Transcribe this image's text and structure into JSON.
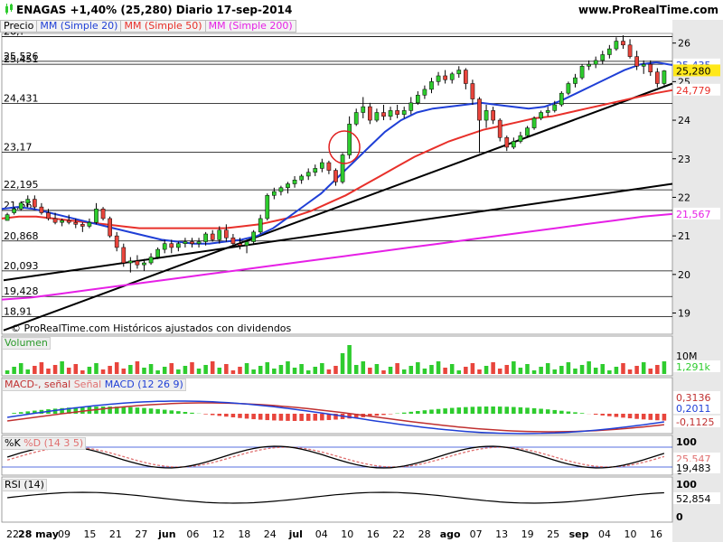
{
  "header": {
    "title": "ENAGAS   +1,40% (25,280)   Diario   17-sep-2014",
    "site": "www.ProRealTime.com"
  },
  "legend": {
    "price": "Precio",
    "ma20": "MM (Simple 20)",
    "ma50": "MM (Simple 50)",
    "ma200": "MM (Simple 200)"
  },
  "footnote": "© ProRealTime.com  Históricos ajustados con dividendos",
  "panels": {
    "volume": "Volumen",
    "macd": {
      "a": "MACD-, señal",
      "b": "Señal",
      "c": "MACD (12 26 9)"
    },
    "stoch": {
      "a": "%K",
      "b": "%D (14 3 5)"
    },
    "rsi": "RSI (14)"
  },
  "colors": {
    "up": "#2ecc2e",
    "down": "#e8453c",
    "ma20": "#1f3fd6",
    "ma50": "#e8302a",
    "ma200": "#e620e6",
    "circle": "#e02020",
    "right_bg": "#e8e8e8"
  },
  "chart_data": {
    "type": "candlestick",
    "x_labels": [
      "22",
      "28 may",
      "09",
      "15",
      "21",
      "27",
      "jun",
      "06",
      "12",
      "18",
      "24",
      "jul",
      "04",
      "10",
      "16",
      "22",
      "28",
      "ago",
      "07",
      "13",
      "19",
      "25",
      "sep",
      "04",
      "10",
      "16"
    ],
    "price_axis_ticks": [
      19,
      20,
      21,
      22,
      23,
      24,
      25,
      26
    ],
    "price_levels": [
      "26,?",
      "25,526",
      "25,451",
      "24,431",
      "23,17",
      "22,195",
      "21,66",
      "20,868",
      "20,093",
      "19,428",
      "18,91"
    ],
    "last_price": "25,280",
    "ma20_last": "25,435",
    "ma50_last": "24,779",
    "ma200_last": "21,567",
    "candles": [
      [
        21.55,
        21.6,
        21.45,
        21.4,
        1
      ],
      [
        21.6,
        21.75,
        21.55,
        21.7,
        1
      ],
      [
        21.7,
        21.9,
        21.65,
        21.85,
        1
      ],
      [
        21.85,
        22.05,
        21.75,
        21.95,
        1
      ],
      [
        21.95,
        22.05,
        21.7,
        21.75,
        0
      ],
      [
        21.75,
        21.85,
        21.55,
        21.6,
        0
      ],
      [
        21.6,
        21.7,
        21.4,
        21.45,
        0
      ],
      [
        21.45,
        21.6,
        21.3,
        21.35,
        0
      ],
      [
        21.35,
        21.45,
        21.25,
        21.4,
        1
      ],
      [
        21.4,
        21.55,
        21.3,
        21.35,
        0
      ],
      [
        21.35,
        21.45,
        21.2,
        21.3,
        0
      ],
      [
        21.3,
        21.35,
        21.1,
        21.25,
        0
      ],
      [
        21.25,
        21.45,
        21.2,
        21.35,
        1
      ],
      [
        21.35,
        21.85,
        21.3,
        21.7,
        1
      ],
      [
        21.7,
        21.75,
        21.4,
        21.45,
        0
      ],
      [
        21.45,
        21.5,
        20.95,
        21.0,
        0
      ],
      [
        21.0,
        21.1,
        20.6,
        20.7,
        0
      ],
      [
        20.7,
        20.8,
        20.2,
        20.3,
        0
      ],
      [
        20.3,
        20.45,
        20.05,
        20.35,
        1
      ],
      [
        20.35,
        20.5,
        20.15,
        20.25,
        0
      ],
      [
        20.25,
        20.4,
        20.1,
        20.3,
        1
      ],
      [
        20.3,
        20.55,
        20.25,
        20.45,
        1
      ],
      [
        20.45,
        20.7,
        20.4,
        20.65,
        1
      ],
      [
        20.65,
        20.9,
        20.55,
        20.8,
        1
      ],
      [
        20.8,
        20.9,
        20.55,
        20.7,
        0
      ],
      [
        20.7,
        20.85,
        20.6,
        20.8,
        1
      ],
      [
        20.8,
        20.95,
        20.7,
        20.85,
        1
      ],
      [
        20.85,
        20.95,
        20.7,
        20.8,
        0
      ],
      [
        20.8,
        20.95,
        20.7,
        20.85,
        1
      ],
      [
        20.85,
        21.1,
        20.75,
        21.05,
        1
      ],
      [
        21.05,
        21.15,
        20.85,
        20.9,
        0
      ],
      [
        20.9,
        21.25,
        20.8,
        21.15,
        1
      ],
      [
        21.15,
        21.3,
        20.85,
        20.95,
        0
      ],
      [
        20.95,
        21.05,
        20.7,
        20.8,
        0
      ],
      [
        20.8,
        20.95,
        20.65,
        20.75,
        0
      ],
      [
        20.75,
        20.9,
        20.55,
        20.85,
        1
      ],
      [
        20.85,
        21.15,
        20.8,
        21.1,
        1
      ],
      [
        21.1,
        21.55,
        21.05,
        21.45,
        1
      ],
      [
        21.45,
        22.1,
        21.4,
        22.05,
        1
      ],
      [
        22.05,
        22.25,
        21.95,
        22.15,
        1
      ],
      [
        22.15,
        22.3,
        22.05,
        22.25,
        1
      ],
      [
        22.25,
        22.4,
        22.1,
        22.35,
        1
      ],
      [
        22.35,
        22.55,
        22.25,
        22.45,
        1
      ],
      [
        22.45,
        22.6,
        22.35,
        22.55,
        1
      ],
      [
        22.55,
        22.75,
        22.45,
        22.65,
        1
      ],
      [
        22.65,
        22.85,
        22.55,
        22.75,
        1
      ],
      [
        22.75,
        23.0,
        22.65,
        22.9,
        1
      ],
      [
        22.9,
        22.95,
        22.6,
        22.7,
        0
      ],
      [
        22.7,
        22.75,
        22.3,
        22.4,
        0
      ],
      [
        22.4,
        23.15,
        22.35,
        23.1,
        1
      ],
      [
        23.1,
        24.1,
        23.0,
        23.9,
        1
      ],
      [
        23.9,
        24.3,
        23.85,
        24.2,
        1
      ],
      [
        24.2,
        24.6,
        24.05,
        24.35,
        1
      ],
      [
        24.35,
        24.45,
        23.9,
        24.0,
        0
      ],
      [
        24.0,
        24.3,
        23.95,
        24.2,
        1
      ],
      [
        24.2,
        24.4,
        24.0,
        24.1,
        0
      ],
      [
        24.1,
        24.35,
        24.0,
        24.25,
        1
      ],
      [
        24.25,
        24.4,
        24.05,
        24.15,
        0
      ],
      [
        24.15,
        24.35,
        24.05,
        24.25,
        1
      ],
      [
        24.25,
        24.6,
        24.15,
        24.45,
        1
      ],
      [
        24.45,
        24.75,
        24.4,
        24.65,
        1
      ],
      [
        24.65,
        24.9,
        24.55,
        24.8,
        1
      ],
      [
        24.8,
        25.1,
        24.7,
        25.0,
        1
      ],
      [
        25.0,
        25.25,
        24.9,
        25.15,
        1
      ],
      [
        25.15,
        25.3,
        24.95,
        25.05,
        0
      ],
      [
        25.05,
        25.25,
        24.95,
        25.2,
        1
      ],
      [
        25.2,
        25.4,
        25.1,
        25.3,
        1
      ],
      [
        25.3,
        25.35,
        24.8,
        24.95,
        0
      ],
      [
        24.95,
        25.05,
        24.4,
        24.55,
        0
      ],
      [
        24.55,
        24.6,
        23.15,
        24.0,
        0
      ],
      [
        24.0,
        24.4,
        23.8,
        24.25,
        1
      ],
      [
        24.25,
        24.35,
        23.9,
        24.0,
        0
      ],
      [
        24.0,
        24.05,
        23.45,
        23.55,
        0
      ],
      [
        23.55,
        23.6,
        23.2,
        23.3,
        0
      ],
      [
        23.3,
        23.55,
        23.25,
        23.45,
        1
      ],
      [
        23.45,
        23.7,
        23.4,
        23.6,
        1
      ],
      [
        23.6,
        23.85,
        23.55,
        23.8,
        1
      ],
      [
        23.8,
        24.1,
        23.75,
        24.05,
        1
      ],
      [
        24.05,
        24.25,
        24.0,
        24.2,
        1
      ],
      [
        24.2,
        24.35,
        24.1,
        24.25,
        1
      ],
      [
        24.25,
        24.5,
        24.2,
        24.4,
        1
      ],
      [
        24.4,
        24.75,
        24.35,
        24.7,
        1
      ],
      [
        24.7,
        25.0,
        24.65,
        24.95,
        1
      ],
      [
        24.95,
        25.2,
        24.85,
        25.1,
        1
      ],
      [
        25.1,
        25.45,
        25.05,
        25.4,
        1
      ],
      [
        25.4,
        25.55,
        25.3,
        25.45,
        1
      ],
      [
        25.45,
        25.65,
        25.35,
        25.55,
        1
      ],
      [
        25.55,
        25.8,
        25.45,
        25.7,
        1
      ],
      [
        25.7,
        25.95,
        25.6,
        25.85,
        1
      ],
      [
        25.85,
        26.15,
        25.8,
        26.05,
        1
      ],
      [
        26.05,
        26.2,
        25.85,
        25.95,
        0
      ],
      [
        25.95,
        26.1,
        25.6,
        25.65,
        0
      ],
      [
        25.65,
        25.8,
        25.3,
        25.4,
        0
      ],
      [
        25.4,
        25.55,
        25.2,
        25.45,
        1
      ],
      [
        25.45,
        25.55,
        25.15,
        25.25,
        0
      ],
      [
        25.25,
        25.35,
        24.85,
        24.95,
        0
      ],
      [
        24.95,
        25.3,
        24.9,
        25.28,
        1
      ]
    ],
    "ma20": [
      21.7,
      21.75,
      21.7,
      21.6,
      21.5,
      21.4,
      21.3,
      21.2,
      21.1,
      21.0,
      20.9,
      20.85,
      20.8,
      20.8,
      20.85,
      20.9,
      21.0,
      21.2,
      21.5,
      21.8,
      22.1,
      22.5,
      22.9,
      23.3,
      23.7,
      24.0,
      24.2,
      24.3,
      24.35,
      24.4,
      24.45,
      24.4,
      24.35,
      24.3,
      24.35,
      24.5,
      24.7,
      24.9,
      25.1,
      25.3,
      25.45,
      25.5,
      25.43
    ],
    "ma50": [
      21.45,
      21.5,
      21.5,
      21.45,
      21.4,
      21.35,
      21.3,
      21.25,
      21.2,
      21.2,
      21.2,
      21.2,
      21.2,
      21.2,
      21.25,
      21.3,
      21.4,
      21.5,
      21.65,
      21.85,
      22.05,
      22.3,
      22.55,
      22.8,
      23.05,
      23.25,
      23.45,
      23.6,
      23.75,
      23.85,
      23.95,
      24.05,
      24.1,
      24.2,
      24.3,
      24.4,
      24.5,
      24.6,
      24.7,
      24.78
    ],
    "ma200": [
      19.35,
      19.4,
      19.5,
      19.6,
      19.7,
      19.8,
      19.9,
      20.0,
      20.1,
      20.2,
      20.3,
      20.4,
      20.5,
      20.6,
      20.7,
      20.8,
      20.9,
      21.0,
      21.1,
      21.2,
      21.3,
      21.4,
      21.5,
      21.567
    ],
    "trendlines": [
      {
        "from": [
          0,
          18.55
        ],
        "to": [
          105,
          24.95
        ]
      },
      {
        "from": [
          0,
          19.85
        ],
        "to": [
          105,
          22.35
        ]
      }
    ],
    "panel_values": {
      "volume_scale": "10M",
      "volume_last": "1,291k",
      "macd": [
        "0,3136",
        "0,2011",
        "-0,1125"
      ],
      "stoch_ticks": [
        "100",
        "0"
      ],
      "stoch_values": [
        "25,547",
        "19,483"
      ],
      "rsi_ticks": [
        "100",
        "0"
      ],
      "rsi_value": "52,854"
    }
  }
}
